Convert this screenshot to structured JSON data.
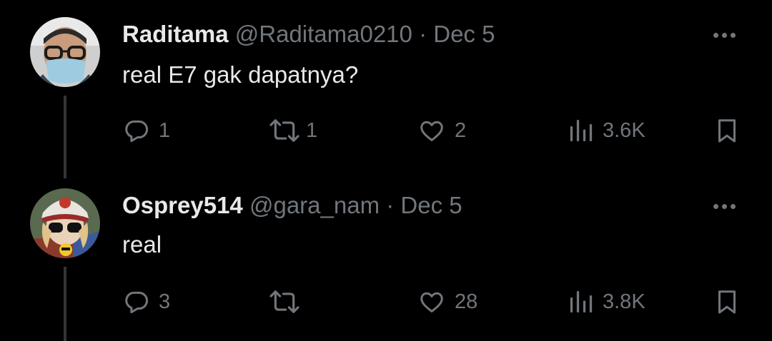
{
  "tweets": [
    {
      "author_name": "Raditama",
      "handle": "@Raditama0210",
      "separator": "·",
      "date": "Dec 5",
      "text": "real E7 gak dapatnya?",
      "replies": "1",
      "reposts": "1",
      "likes": "2",
      "views": "3.6K"
    },
    {
      "author_name": "Osprey514",
      "handle": "@gara_nam",
      "separator": "·",
      "date": "Dec 5",
      "text": "real",
      "replies": "3",
      "reposts": "",
      "likes": "28",
      "views": "3.8K"
    }
  ],
  "colors": {
    "background": "#000000",
    "primary_text": "#e7e9ea",
    "secondary_text": "#71767b",
    "thread_line": "#333639"
  },
  "icons": [
    "reply-icon",
    "repost-icon",
    "like-icon",
    "views-icon",
    "bookmark-icon",
    "more-icon"
  ]
}
